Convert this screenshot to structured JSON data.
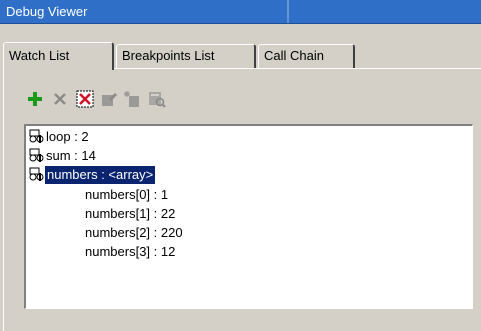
{
  "window": {
    "title": "Debug Viewer",
    "title_right_glyph": "✕"
  },
  "tabs": [
    {
      "label": "Watch List",
      "active": true
    },
    {
      "label": "Breakpoints List",
      "active": false
    },
    {
      "label": "Call Chain",
      "active": false
    }
  ],
  "toolbar": {
    "buttons": [
      {
        "name": "add-watch",
        "icon": "plus-icon",
        "enabled": true
      },
      {
        "name": "delete-watch",
        "icon": "x-icon",
        "enabled": false
      },
      {
        "name": "delete-all-watches",
        "icon": "x-box-icon",
        "enabled": true
      },
      {
        "name": "edit-watch",
        "icon": "edit-icon",
        "enabled": false
      },
      {
        "name": "new-watch",
        "icon": "sparkle-icon",
        "enabled": false
      },
      {
        "name": "view-watch",
        "icon": "view-icon",
        "enabled": false
      }
    ]
  },
  "watch_list": {
    "items": [
      {
        "label": "loop : 2"
      },
      {
        "label": "sum : 14"
      },
      {
        "label": "numbers : <array>",
        "selected": true,
        "children": [
          {
            "label": "numbers[0] : 1"
          },
          {
            "label": "numbers[1] : 22"
          },
          {
            "label": "numbers[2] : 220"
          },
          {
            "label": "numbers[3] : 12"
          }
        ]
      }
    ]
  },
  "colors": {
    "title_bar": "#2f6fc7",
    "selection": "#0a2470",
    "face": "#d4d0c8",
    "add_icon": "#1a9a1a",
    "delete_all_icon": "#d0142a"
  }
}
